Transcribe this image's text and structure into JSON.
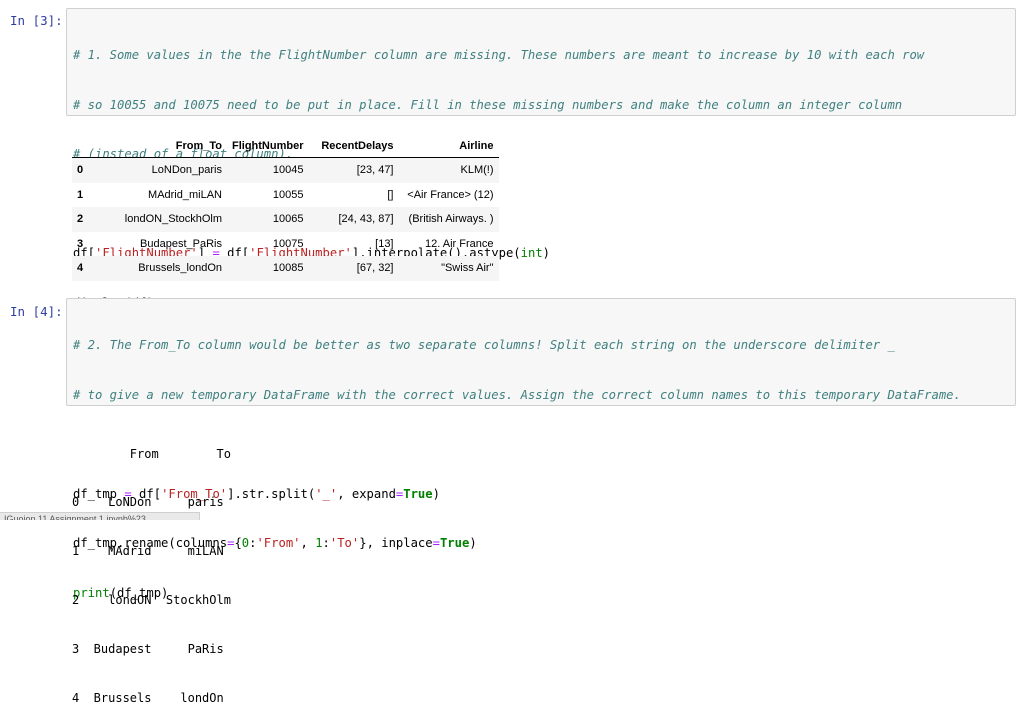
{
  "cell3": {
    "prompt": "In [3]:",
    "comment_lines": [
      "# 1. Some values in the the FlightNumber column are missing. These numbers are meant to increase by 10 with each row",
      "# so 10055 and 10075 need to be put in place. Fill in these missing numbers and make the column an integer column",
      "# (instead of a float column)."
    ],
    "code": {
      "l1_a": "df[",
      "l1_str1": "'FlightNumber'",
      "l1_b": "] ",
      "l1_eq": "=",
      "l1_c": " df[",
      "l1_str2": "'FlightNumber'",
      "l1_d": "].interpolate().astype(",
      "l1_int": "int",
      "l1_e": ")",
      "l2": "display(df)"
    }
  },
  "dataframe": {
    "columns": [
      "From_To",
      "FlightNumber",
      "RecentDelays",
      "Airline"
    ],
    "rows": [
      {
        "index": "0",
        "From_To": "LoNDon_paris",
        "FlightNumber": "10045",
        "RecentDelays": "[23, 47]",
        "Airline": "KLM(!)"
      },
      {
        "index": "1",
        "From_To": "MAdrid_miLAN",
        "FlightNumber": "10055",
        "RecentDelays": "[]",
        "Airline": "<Air France> (12)"
      },
      {
        "index": "2",
        "From_To": "londON_StockhOlm",
        "FlightNumber": "10065",
        "RecentDelays": "[24, 43, 87]",
        "Airline": "(British Airways. )"
      },
      {
        "index": "3",
        "From_To": "Budapest_PaRis",
        "FlightNumber": "10075",
        "RecentDelays": "[13]",
        "Airline": "12. Air France"
      },
      {
        "index": "4",
        "From_To": "Brussels_londOn",
        "FlightNumber": "10085",
        "RecentDelays": "[67, 32]",
        "Airline": "\"Swiss Air\""
      }
    ]
  },
  "cell4": {
    "prompt": "In [4]:",
    "comment_lines": [
      "# 2. The From_To column would be better as two separate columns! Split each string on the underscore delimiter _",
      "# to give a new temporary DataFrame with the correct values. Assign the correct column names to this temporary DataFrame."
    ],
    "code": {
      "l1_a": "df_tmp ",
      "l1_eq": "=",
      "l1_b": " df[",
      "l1_str1": "'From_To'",
      "l1_c": "].str.split(",
      "l1_str2": "'_'",
      "l1_d": ", expand",
      "l1_eq2": "=",
      "l1_true": "True",
      "l1_e": ")",
      "l2_a": "df_tmp.rename(columns",
      "l2_eq": "=",
      "l2_b": "{",
      "l2_n0": "0",
      "l2_c": ":",
      "l2_s1": "'From'",
      "l2_d": ", ",
      "l2_n1": "1",
      "l2_e": ":",
      "l2_s2": "'To'",
      "l2_f": "}, inplace",
      "l2_eq2": "=",
      "l2_true": "True",
      "l2_g": ")",
      "l3_print": "print",
      "l3_b": "(df_tmp)"
    }
  },
  "print_output": [
    "        From        To",
    "0    LoNDon     paris",
    "1    MAdrid     miLAN",
    "2    londON  StockhOlm",
    "3  Budapest     PaRis",
    "4  Brussels    londOn"
  ],
  "status_text": "IGuoion 11 Assignment 1 ipynb%23"
}
